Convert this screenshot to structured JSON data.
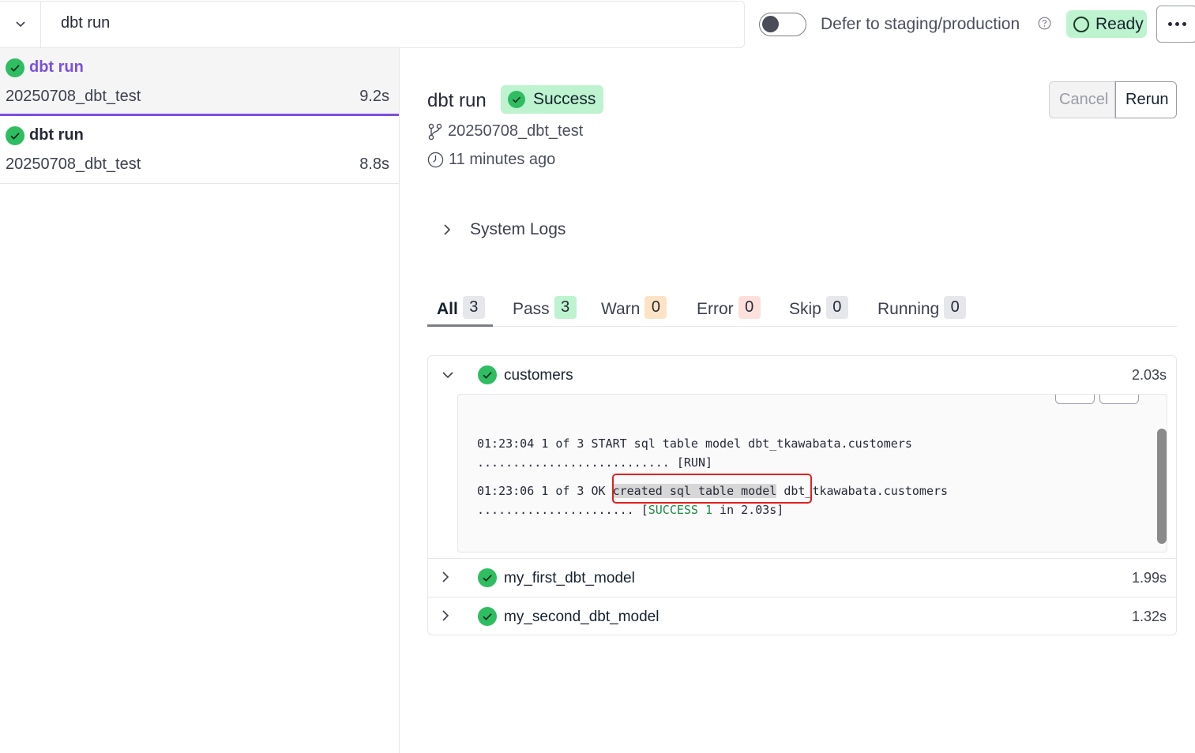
{
  "topbar": {
    "command_value": "dbt run",
    "defer_label": "Defer to staging/production",
    "ready_label": "Ready"
  },
  "sidebar": {
    "runs": [
      {
        "title": "dbt run",
        "branch": "20250708_dbt_test",
        "duration": "9.2s",
        "active": true
      },
      {
        "title": "dbt run",
        "branch": "20250708_dbt_test",
        "duration": "8.8s",
        "active": false
      }
    ]
  },
  "run": {
    "title": "dbt run",
    "status": "Success",
    "branch": "20250708_dbt_test",
    "time_ago": "11 minutes ago",
    "cancel_label": "Cancel",
    "rerun_label": "Rerun"
  },
  "system_logs_label": "System Logs",
  "tabs": [
    {
      "label": "All",
      "count": "3",
      "color": "#e6e7eb"
    },
    {
      "label": "Pass",
      "count": "3",
      "color": "#bdf3ce"
    },
    {
      "label": "Warn",
      "count": "0",
      "color": "#fde3c4"
    },
    {
      "label": "Error",
      "count": "0",
      "color": "#fde0db"
    },
    {
      "label": "Skip",
      "count": "0",
      "color": "#e6e7eb"
    },
    {
      "label": "Running",
      "count": "0",
      "color": "#e6e7eb"
    }
  ],
  "results": [
    {
      "name": "customers",
      "time": "2.03s",
      "expanded": true
    },
    {
      "name": "my_first_dbt_model",
      "time": "1.99s",
      "expanded": false
    },
    {
      "name": "my_second_dbt_model",
      "time": "1.32s",
      "expanded": false
    }
  ],
  "log": {
    "line1_a": "01:23:04 1 of 3 START sql table model dbt_tkawabata.customers",
    "line1_b": "........................... [RUN]",
    "line2_prefix": "01:23:06 1 of 3 OK ",
    "line2_highlight": "created sql table model",
    "line2_suffix": " dbt_tkawabata.customers",
    "line3_dots": "...................... [",
    "line3_success": "SUCCESS 1",
    "line3_tail": " in 2.03s]"
  },
  "colors": {
    "accent": "#7b4fe0",
    "success_bg": "#bdf3ce",
    "success_icon": "#2fbd62",
    "highlight_border": "#e02020"
  }
}
